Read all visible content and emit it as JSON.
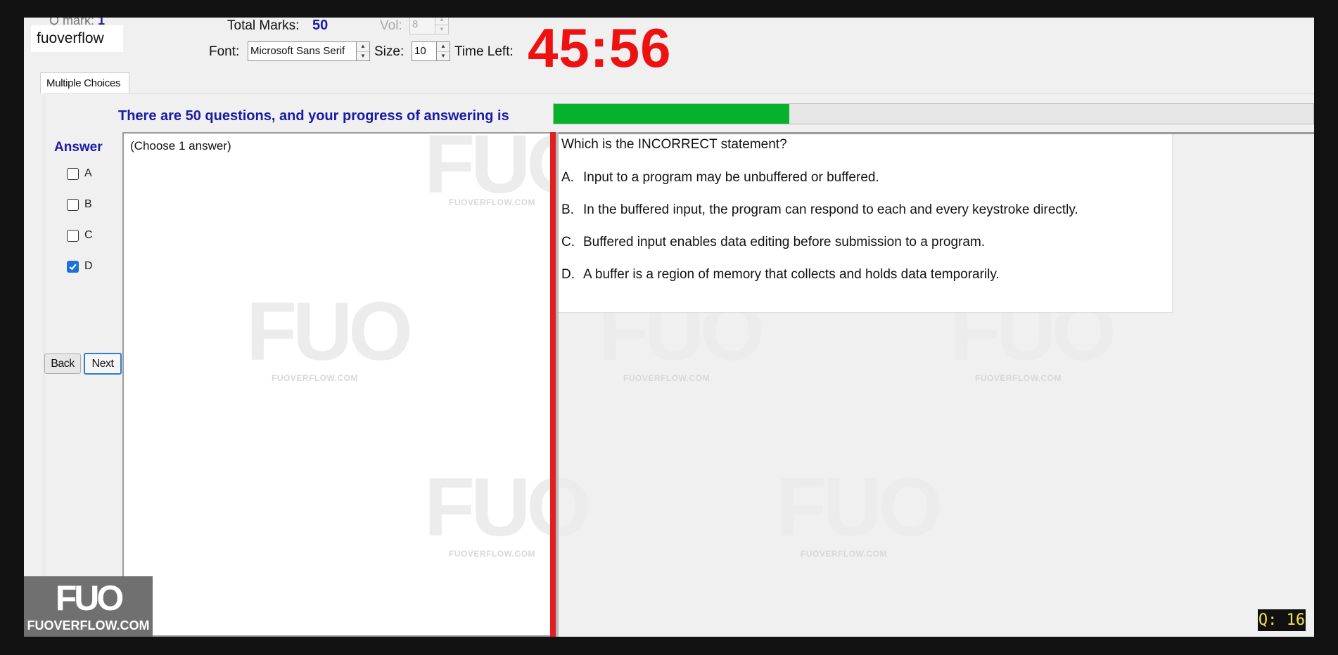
{
  "header": {
    "q_mark_label": "Q mark:",
    "q_mark_value": "1",
    "brand": "fuoverflow",
    "total_marks_label": "Total Marks:",
    "total_marks_value": "50",
    "vol_label": "Vol:",
    "vol_value": "8",
    "font_label": "Font:",
    "font_value": "Microsoft Sans Serif",
    "size_label": "Size:",
    "size_value": "10",
    "time_left_label": "Time Left:",
    "time_left_value": "45:56"
  },
  "tab": {
    "label": "Multiple Choices"
  },
  "progress": {
    "text": "There are 50 questions, and your progress of answering is",
    "fraction": 0.31,
    "color": "#06b12b"
  },
  "answer": {
    "title": "Answer",
    "options": [
      {
        "label": "A",
        "checked": false
      },
      {
        "label": "B",
        "checked": false
      },
      {
        "label": "C",
        "checked": false
      },
      {
        "label": "D",
        "checked": true
      }
    ],
    "back_label": "Back",
    "next_label": "Next",
    "hint": "(Choose 1 answer)"
  },
  "question": {
    "prompt": "Which is the INCORRECT statement?",
    "choices": [
      {
        "letter": "A.",
        "text": "Input to a program may be unbuffered or buffered."
      },
      {
        "letter": "B.",
        "text": "In the buffered input, the program can respond to each and every keystroke directly."
      },
      {
        "letter": "C.",
        "text": "Buffered input enables data editing before submission to a program."
      },
      {
        "letter": "D.",
        "text": "A buffer is a region of memory that collects and holds data temporarily."
      }
    ]
  },
  "watermark": {
    "mark": "FUO",
    "site": "FUOVERFLOW.COM"
  },
  "logo": {
    "mark": "FUO",
    "site": "FUOVERFLOW.COM"
  },
  "question_counter": "Q: 16",
  "colors": {
    "accent_blue": "#1a1aa8",
    "timer_red": "#ee1111",
    "divider_red": "#e02020",
    "counter_text": "#f5e24a"
  }
}
